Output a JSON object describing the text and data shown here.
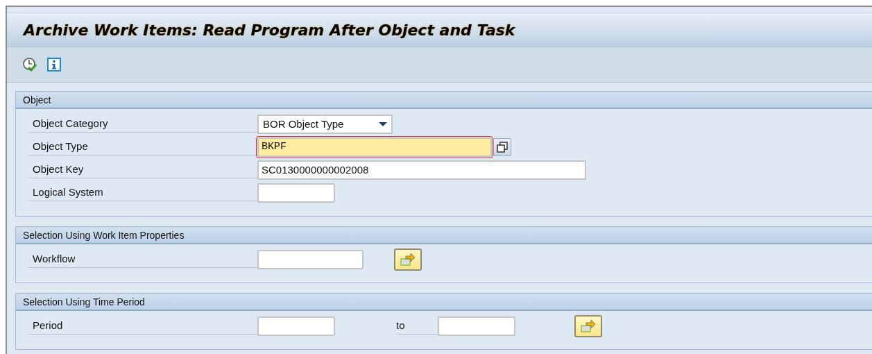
{
  "window": {
    "title": "Archive Work Items: Read Program After Object and Task"
  },
  "toolbar": [
    {
      "kind": "execute"
    },
    {
      "kind": "info"
    }
  ],
  "sections": [
    {
      "title": "Object",
      "rows": [
        {
          "label": "Object Category",
          "items": [
            {
              "kind": "dropdown",
              "value": "BOR Object Type"
            }
          ]
        },
        {
          "label": "Object Type",
          "items": [
            {
              "kind": "input",
              "value": "BKPF",
              "focused": true
            },
            {
              "kind": "multi"
            }
          ]
        },
        {
          "label": "Object Key",
          "items": [
            {
              "kind": "input",
              "value": "SC0130000000002008",
              "focused": false
            }
          ]
        },
        {
          "label": "Logical System",
          "items": [
            {
              "kind": "input",
              "focused": false
            }
          ]
        }
      ]
    },
    {
      "title": "Selection Using Work Item Properties",
      "rows": [
        {
          "label": "Workflow",
          "items": [
            {
              "kind": "input",
              "focused": false
            },
            {
              "kind": "more"
            }
          ]
        }
      ]
    },
    {
      "title": "Selection Using Time Period",
      "rows": [
        {
          "label": "Period",
          "items": [
            {
              "kind": "input",
              "focused": false
            },
            {
              "kind": "text",
              "value": "to"
            },
            {
              "kind": "input",
              "focused": false
            },
            {
              "kind": "more"
            }
          ]
        }
      ]
    }
  ]
}
